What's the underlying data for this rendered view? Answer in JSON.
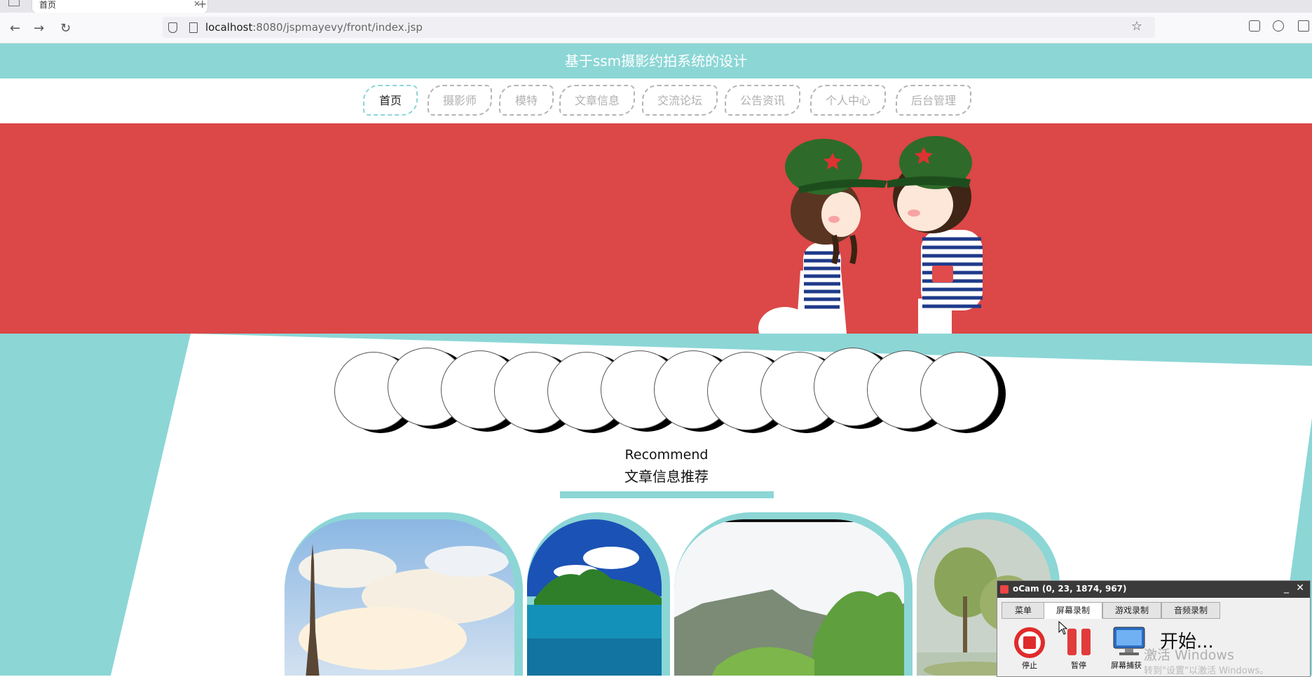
{
  "browser": {
    "tab_title": "首页",
    "tab_close": "×",
    "new_tab": "+",
    "url_host": "localhost",
    "url_path": ":8080/jspmayevy/front/index.jsp"
  },
  "site": {
    "title": "基于ssm摄影约拍系统的设计",
    "nav": [
      "首页",
      "摄影师",
      "模特",
      "文章信息",
      "交流论坛",
      "公告资讯",
      "个人中心",
      "后台管理"
    ],
    "recommend_en": "Recommend",
    "recommend_cn": "文章信息推荐"
  },
  "ocam": {
    "title": "oCam (0, 23, 1874, 967)",
    "tabs": [
      "菜单",
      "屏幕录制",
      "游戏录制",
      "音频录制"
    ],
    "active_tab": "屏幕录制",
    "stop": "停止",
    "pause": "暂停",
    "capture": "屏幕捕获",
    "start": "开始..."
  },
  "watermark": {
    "line1": "激活 Windows",
    "line2": "转到\"设置\"以激活 Windows。"
  },
  "colors": {
    "accent": "#8cd6d6",
    "banner": "#dc4747"
  }
}
